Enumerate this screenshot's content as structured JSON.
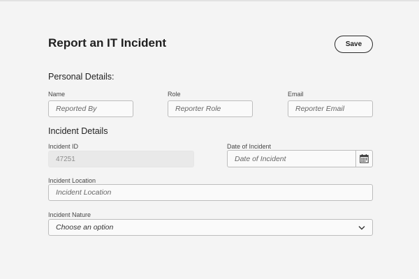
{
  "header": {
    "title": "Report an IT Incident",
    "save_label": "Save"
  },
  "personal": {
    "title": "Personal Details:",
    "name_label": "Name",
    "name_placeholder": "Reported By",
    "role_label": "Role",
    "role_placeholder": "Reporter Role",
    "email_label": "Email",
    "email_placeholder": "Reporter Email"
  },
  "incident": {
    "title": "Incident Details",
    "id_label": "Incident ID",
    "id_value": "47251",
    "date_label": "Date of Incident",
    "date_placeholder": "Date of Incident",
    "location_label": "Incident Location",
    "location_placeholder": "Incident Location",
    "nature_label": "Incident Nature",
    "nature_selected": "Choose an option"
  },
  "icons": {
    "calendar": "calendar-icon",
    "dropdown": "chevron-down-icon"
  }
}
